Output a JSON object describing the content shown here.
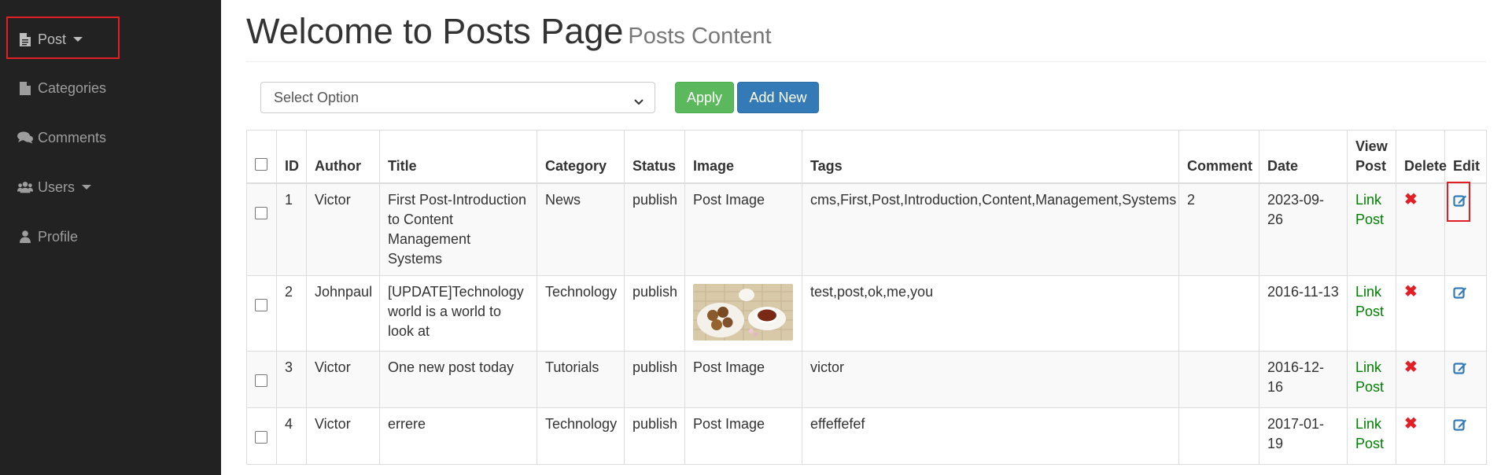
{
  "sidebar": {
    "items": [
      {
        "label": "Post",
        "icon": "file-icon",
        "has_caret": true,
        "active": true
      },
      {
        "label": "Categories",
        "icon": "file-icon",
        "has_caret": false
      },
      {
        "label": "Comments",
        "icon": "comments-icon",
        "has_caret": false
      },
      {
        "label": "Users",
        "icon": "users-icon",
        "has_caret": true
      },
      {
        "label": "Profile",
        "icon": "user-icon",
        "has_caret": false
      }
    ]
  },
  "header": {
    "title": "Welcome to Posts Page",
    "subtitle": "Posts Content"
  },
  "bulk": {
    "select_value": "Select Option",
    "apply_label": "Apply",
    "add_new_label": "Add New"
  },
  "table": {
    "headers": [
      "ID",
      "Author",
      "Title",
      "Category",
      "Status",
      "Image",
      "Tags",
      "Comment",
      "Date",
      "View Post",
      "Delete",
      "Edit"
    ],
    "rows": [
      {
        "id": "1",
        "author": "Victor",
        "title": "First Post-Introduction to Content Management Systems",
        "category": "News",
        "status": "publish",
        "image": "Post Image",
        "tags": "cms,First,Post,Introduction,Content,Management,Systems",
        "comment": "2",
        "date": "2023-09-26",
        "view": "Link Post"
      },
      {
        "id": "2",
        "author": "Johnpaul",
        "title": "[UPDATE]Technology world is a world to look at",
        "category": "Technology",
        "status": "publish",
        "image": "",
        "tags": "test,post,ok,me,you",
        "comment": "",
        "date": "2016-11-13",
        "view": "Link Post"
      },
      {
        "id": "3",
        "author": "Victor",
        "title": "One new post today",
        "category": "Tutorials",
        "status": "publish",
        "image": "Post Image",
        "tags": "victor",
        "comment": "",
        "date": "2016-12-16",
        "view": "Link Post"
      },
      {
        "id": "4",
        "author": "Victor",
        "title": "errere",
        "category": "Technology",
        "status": "publish",
        "image": "Post Image",
        "tags": "effeffefef",
        "comment": "",
        "date": "2017-01-19",
        "view": "Link Post"
      }
    ]
  },
  "colors": {
    "sidebar_bg": "#222222",
    "apply": "#5cb85c",
    "add_new": "#337ab7",
    "link": "#008000",
    "delete": "#e21f26",
    "edit": "#337ab7",
    "highlight": "#e21f26"
  }
}
